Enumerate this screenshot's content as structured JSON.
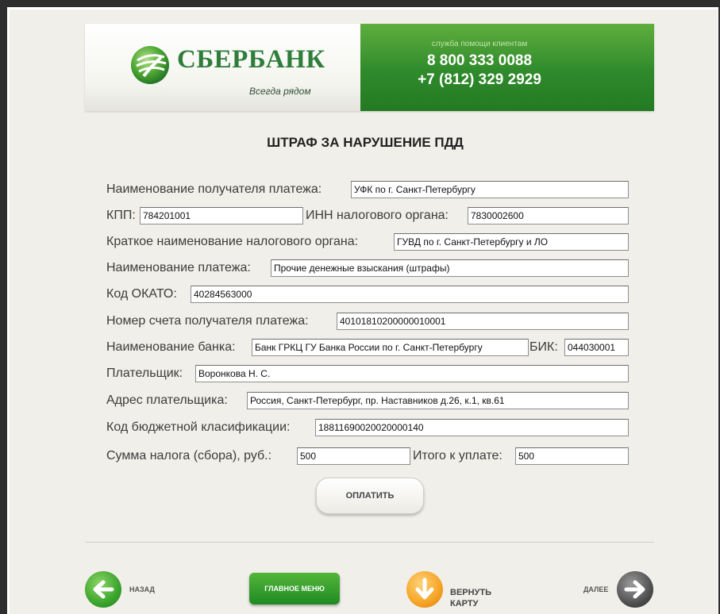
{
  "header": {
    "brand": "СБЕРБАНК",
    "slogan": "Всегда рядом",
    "help_title": "служба помощи клиентам",
    "phone1": "8 800 333 0088",
    "phone2": "+7 (812) 329 2929",
    "brand_color": "#2f7d3a",
    "help_color": "#2f8a2b"
  },
  "page_title": "ШТРАФ ЗА НАРУШЕНИЕ ПДД",
  "form": {
    "recipient_label": "Наименование получателя платежа:",
    "recipient_value": "УФК по г. Санкт-Петербургу",
    "kpp_label": "КПП:",
    "kpp_value": "784201001",
    "inn_label": "ИНН налогового органа:",
    "inn_value": "7830002600",
    "tax_short_label": "Краткое наименование налогового органа:",
    "tax_short_value": "ГУВД по г. Санкт-Петербургу и ЛО",
    "payment_name_label": "Наименование платежа:",
    "payment_name_value": "Прочие денежные взыскания (штрафы)",
    "okato_label": "Код ОКАТО:",
    "okato_value": "40284563000",
    "account_label": "Номер счета получателя платежа:",
    "account_value": "40101810200000010001",
    "bank_label": "Наименование банка:",
    "bank_value": "Банк ГРКЦ ГУ Банка России по г. Санкт-Петербургу",
    "bik_label": "БИК:",
    "bik_value": "044030001",
    "payer_label": "Плательщик:",
    "payer_value": "Воронкова Н. С.",
    "payer_address_label": "Адрес плательщика:",
    "payer_address_value": "Россия, Санкт-Петербург, пр. Наставников д.26, к.1, кв.61",
    "kbk_label": "Код бюджетной класификации:",
    "kbk_value": "18811690020020000140",
    "tax_sum_label": "Сумма налога (сбора), руб.:",
    "tax_sum_value": "500",
    "total_label": "Итого к уплате:",
    "total_value": "500"
  },
  "actions": {
    "pay_button": "ОПЛАТИТЬ"
  },
  "nav": {
    "back": "НАЗАД",
    "main_menu": "ГЛАВНОЕ МЕНЮ",
    "return_card": "ВЕРНУТЬ КАРТУ",
    "next": "ДАЛЕЕ",
    "back_icon": "arrow-left-icon",
    "card_icon": "arrow-down-icon",
    "next_icon": "arrow-right-icon"
  }
}
